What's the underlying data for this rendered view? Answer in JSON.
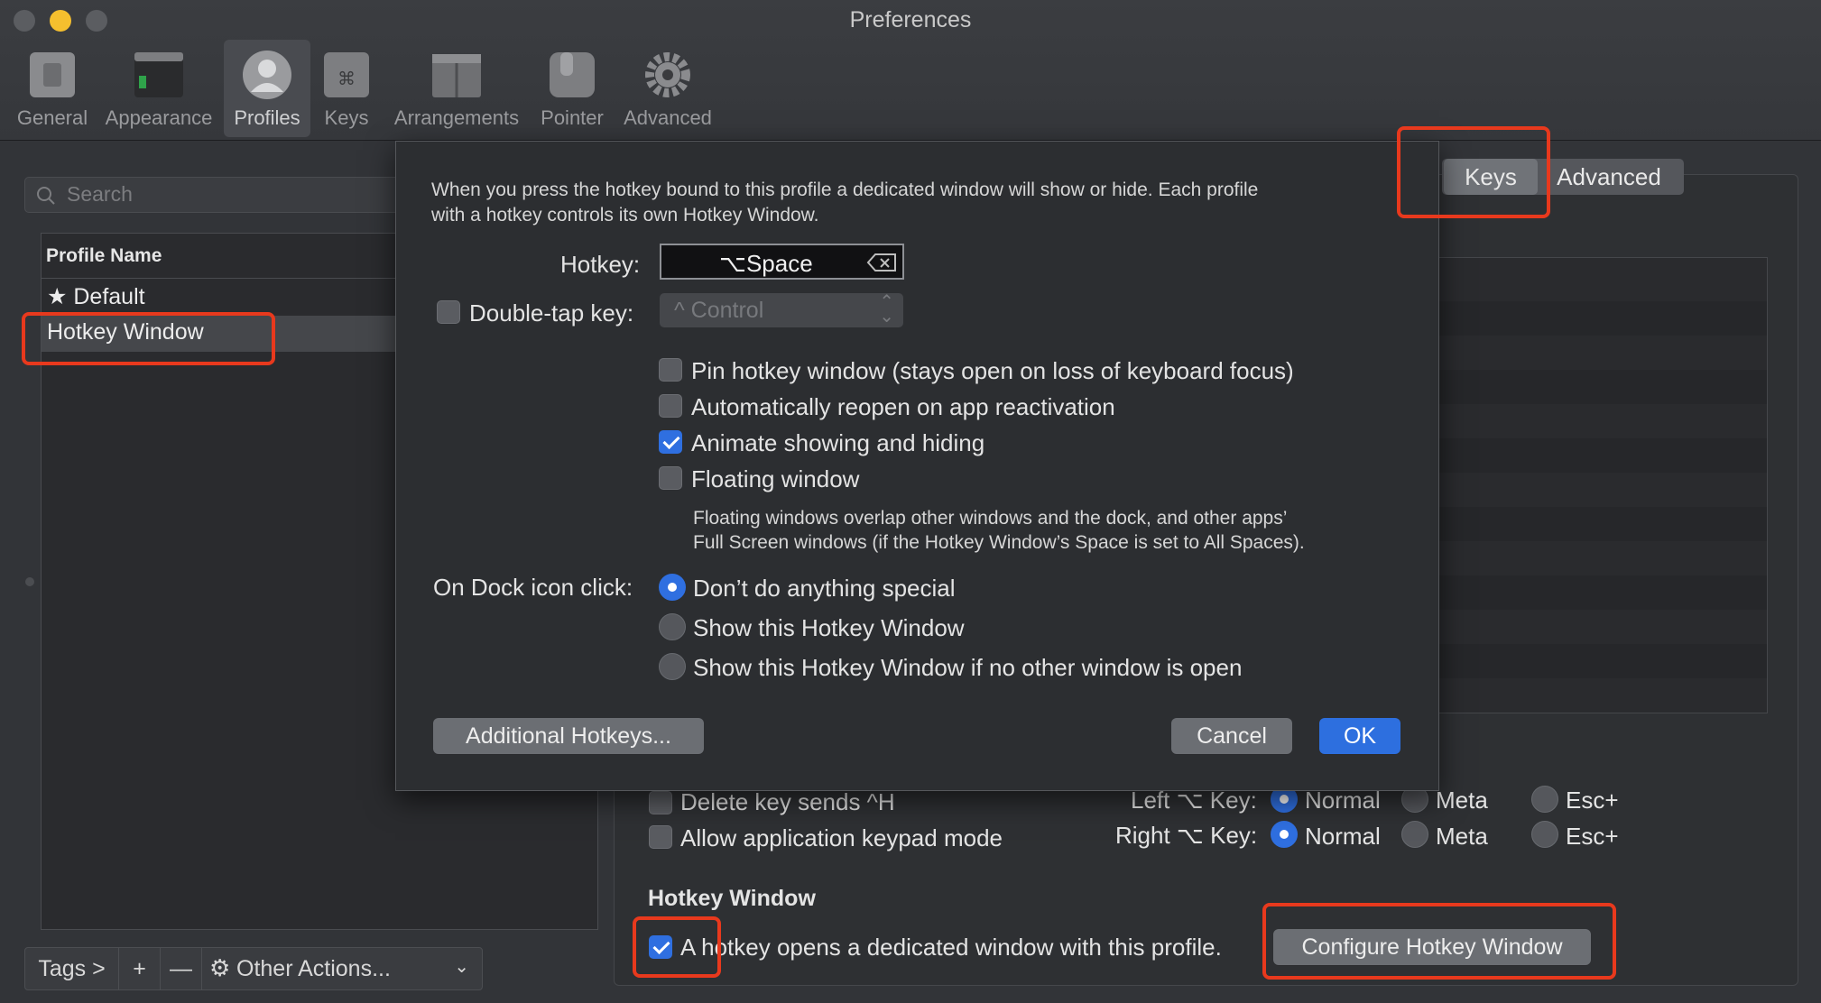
{
  "window": {
    "title": "Preferences"
  },
  "toolbar": [
    {
      "label": "General",
      "icon": "general-icon"
    },
    {
      "label": "Appearance",
      "icon": "appearance-icon"
    },
    {
      "label": "Profiles",
      "icon": "profiles-icon",
      "selected": true
    },
    {
      "label": "Keys",
      "icon": "keys-icon"
    },
    {
      "label": "Arrangements",
      "icon": "arrangements-icon"
    },
    {
      "label": "Pointer",
      "icon": "pointer-icon"
    },
    {
      "label": "Advanced",
      "icon": "gear-icon"
    }
  ],
  "sidebar": {
    "search_placeholder": "Search",
    "column_header": "Profile Name",
    "profiles": [
      {
        "name": "Default",
        "default": true
      },
      {
        "name": "Hotkey Window",
        "selected": true
      }
    ],
    "bottom_bar": {
      "tags": "Tags >",
      "add": "+",
      "remove": "—",
      "other_actions": "Other Actions..."
    }
  },
  "profile_tabs": {
    "keys": "Keys",
    "advanced": "Advanced"
  },
  "keys_panel": {
    "delete_key_sends": "Delete key sends ^H",
    "allow_keypad": "Allow application keypad mode",
    "left_key_label": "Left ⌥ Key:",
    "right_key_label": "Right ⌥ Key:",
    "key_options": [
      "Normal",
      "Meta",
      "Esc+"
    ],
    "left_selected": "Normal",
    "right_selected": "Normal",
    "hotkey_section_title": "Hotkey Window",
    "hotkey_checkbox_label": "A hotkey opens a dedicated window with this profile.",
    "hotkey_checked": true,
    "configure_button": "Configure Hotkey Window"
  },
  "sheet": {
    "description_line1": "When you press the hotkey bound to this profile a dedicated window will show or hide. Each profile",
    "description_line2": "with a hotkey controls its own Hotkey Window.",
    "hotkey_label": "Hotkey:",
    "hotkey_value": "⌥Space",
    "double_tap_label": "Double-tap key:",
    "double_tap_value": "^ Control",
    "options": [
      {
        "label": "Pin hotkey window (stays open on loss of keyboard focus)",
        "checked": false
      },
      {
        "label": "Automatically reopen on app reactivation",
        "checked": false
      },
      {
        "label": "Animate showing and hiding",
        "checked": true
      },
      {
        "label": "Floating window",
        "checked": false
      }
    ],
    "floating_note_line1": "Floating windows overlap other windows and the dock, and other apps’",
    "floating_note_line2": "Full Screen windows (if the Hotkey Window’s Space is set to All Spaces).",
    "dock_label": "On Dock icon click:",
    "dock_options": [
      {
        "label": "Don’t do anything special",
        "selected": true
      },
      {
        "label": "Show this Hotkey Window",
        "selected": false
      },
      {
        "label": "Show this Hotkey Window if no other window is open",
        "selected": false
      }
    ],
    "additional_hotkeys": "Additional Hotkeys...",
    "cancel": "Cancel",
    "ok": "OK"
  },
  "colors": {
    "accent": "#2f6fe0",
    "highlight": "#e8391d",
    "background": "#323438"
  }
}
